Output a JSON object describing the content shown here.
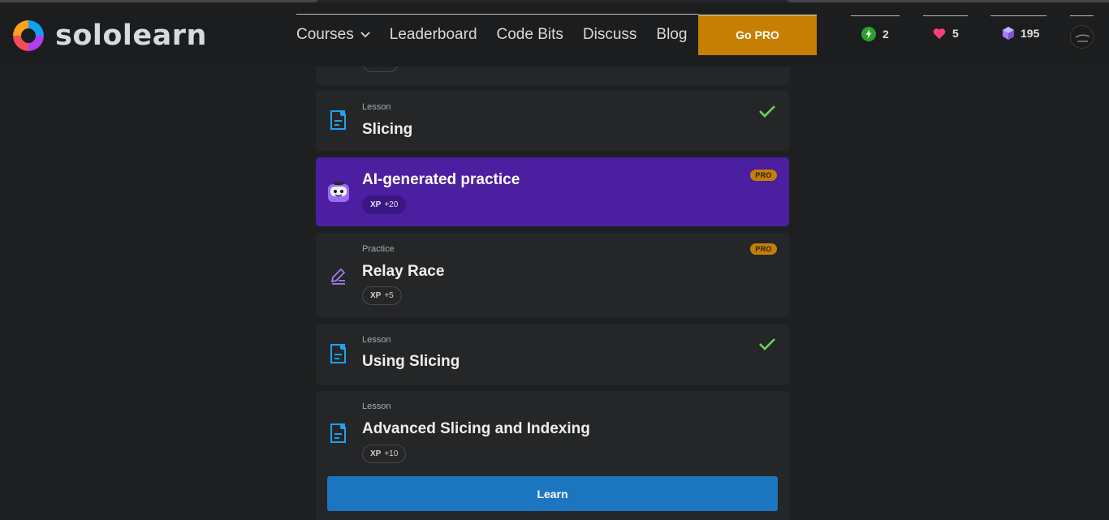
{
  "brand": {
    "name": "sololearn"
  },
  "nav": {
    "courses": "Courses",
    "leaderboard": "Leaderboard",
    "code_bits": "Code Bits",
    "discuss": "Discuss",
    "blog": "Blog"
  },
  "header": {
    "go_pro": "Go PRO",
    "streak": "2",
    "hearts": "5",
    "gems": "195"
  },
  "lessons": [
    {
      "type": "Lesson",
      "title": "Slicing",
      "completed": true
    },
    {
      "type": "",
      "title": "AI-generated practice",
      "badge": "PRO",
      "xp_label": "XP",
      "xp_value": "+20"
    },
    {
      "type": "Practice",
      "title": "Relay Race",
      "badge": "PRO",
      "xp_label": "XP",
      "xp_value": "+5"
    },
    {
      "type": "Lesson",
      "title": "Using Slicing",
      "completed": true
    },
    {
      "type": "Lesson",
      "title": "Advanced Slicing and Indexing",
      "xp_label": "XP",
      "xp_value": "+10"
    }
  ],
  "learn_button": "Learn",
  "colors": {
    "accent_pro": "#c67f03",
    "ai_card": "#4b1f9f",
    "learn_button": "#1c75bf",
    "check": "#6bd65a"
  },
  "icons": {
    "lesson": "lesson-doc-icon",
    "practice": "pencil-icon",
    "ai": "robot-face-icon",
    "streak": "lightning-icon",
    "hearts": "heart-icon",
    "gems": "gem-icon"
  }
}
